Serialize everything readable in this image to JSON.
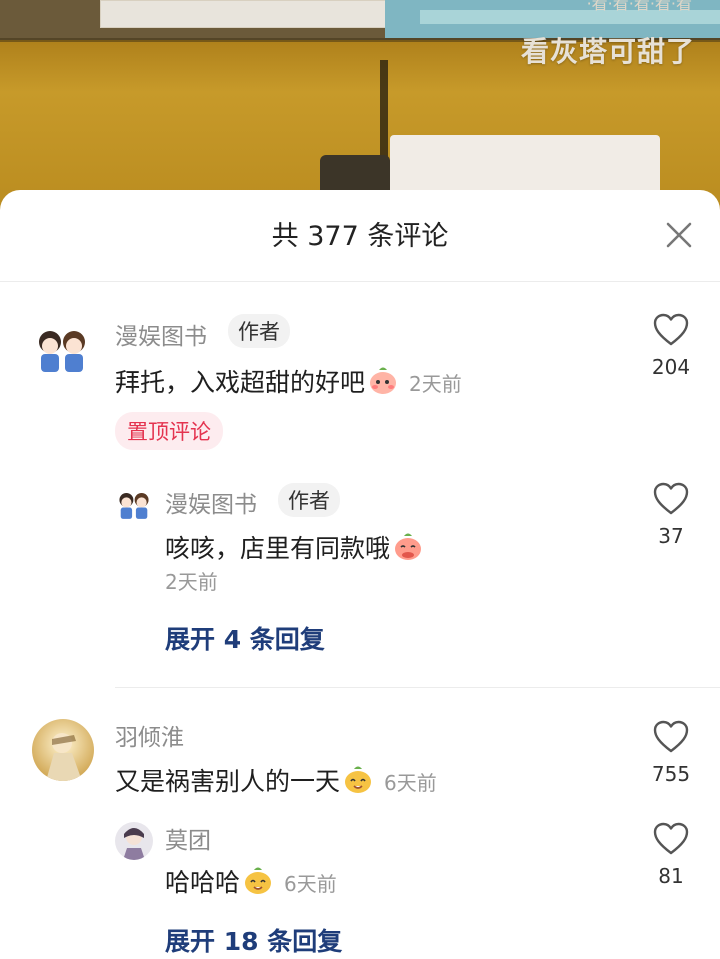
{
  "video": {
    "caption": "看灰塔可甜了",
    "top_text": "·看·看·看·看·看"
  },
  "header": {
    "title": "共 377 条评论"
  },
  "comments": [
    {
      "name": "漫娱图书",
      "tag": "作者",
      "text": "拜托，入戏超甜的好吧",
      "time": "2天前",
      "pinned": "置顶评论",
      "likes": "204",
      "reply": {
        "name": "漫娱图书",
        "tag": "作者",
        "text": "咳咳，店里有同款哦",
        "time": "2天前",
        "likes": "37"
      },
      "expand": "展开 4 条回复"
    },
    {
      "name": "羽倾淮",
      "text": "又是祸害别人的一天",
      "time": "6天前",
      "likes": "755",
      "reply": {
        "name": "莫团",
        "text": "哈哈哈",
        "time": "6天前",
        "likes": "81"
      },
      "expand": "展开 18 条回复"
    }
  ],
  "colors": {
    "accent_blue": "#1f3d7a",
    "pin_red": "#e4334f"
  }
}
